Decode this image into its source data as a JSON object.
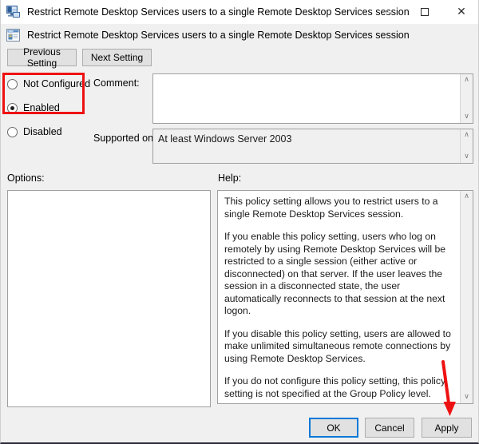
{
  "window": {
    "title": "Restrict Remote Desktop Services users to a single Remote Desktop Services session",
    "title_icon": "remote-desktop-monitor-icon",
    "controls": {
      "minimize": "—",
      "maximize": "□",
      "close": "✕"
    }
  },
  "header": {
    "policy_icon": "group-policy-setting-icon",
    "policy_title": "Restrict Remote Desktop Services users to a single Remote Desktop Services session"
  },
  "nav": {
    "previous_setting": "Previous Setting",
    "next_setting": "Next Setting"
  },
  "state_options": {
    "items": [
      {
        "label": "Not Configured",
        "selected": false
      },
      {
        "label": "Enabled",
        "selected": true
      },
      {
        "label": "Disabled",
        "selected": false
      }
    ]
  },
  "comment": {
    "label": "Comment:",
    "value": "",
    "scroll_up": "∧",
    "scroll_down": "∨"
  },
  "supported_on": {
    "label": "Supported on:",
    "value": "At least Windows Server 2003",
    "scroll_up": "∧",
    "scroll_down": "∨"
  },
  "options": {
    "label": "Options:",
    "value": ""
  },
  "help": {
    "label": "Help:",
    "paragraphs": [
      "This policy setting allows you to restrict users to a single Remote Desktop Services session.",
      "If you enable this policy setting, users who log on remotely by using Remote Desktop Services will be restricted to a single session (either active or disconnected) on that server. If the user leaves the session in a disconnected state, the user automatically reconnects to that session at the next logon.",
      "If you disable this policy setting, users are allowed to make unlimited simultaneous remote connections by using Remote Desktop Services.",
      "If you do not configure this policy setting,  this policy setting is not specified at the Group Policy level."
    ],
    "scroll_up": "∧",
    "scroll_down": "∨"
  },
  "footer": {
    "ok": "OK",
    "cancel": "Cancel",
    "apply": "Apply"
  },
  "annotations": {
    "highlight_color": "#ee1111",
    "arrow_color": "#ee1111",
    "highlight_target": "Not Configured / Enabled radio group",
    "arrow_target": "Apply"
  },
  "colors": {
    "dialog_background": "#f0f0f0",
    "field_background": "#ffffff",
    "focus_border": "#0078d7",
    "button_face": "#e1e1e1"
  }
}
